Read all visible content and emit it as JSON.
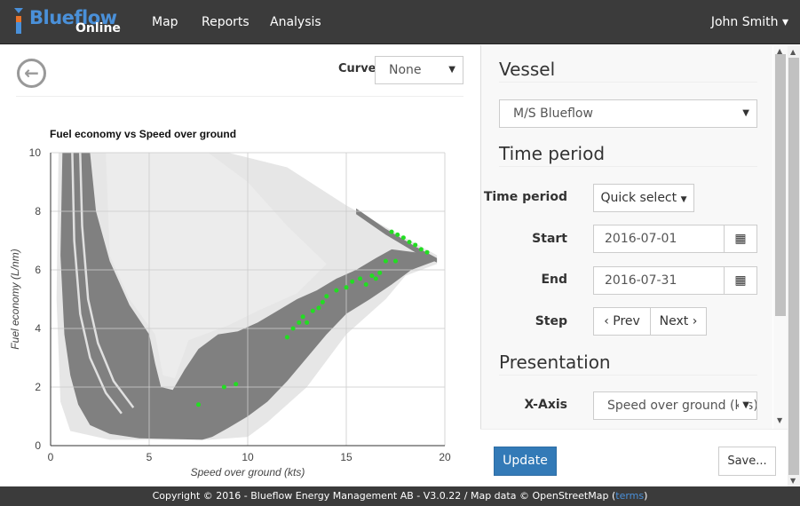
{
  "navbar": {
    "logo_main": "Blueflow",
    "logo_sub": "Online",
    "items": [
      {
        "label": "Map"
      },
      {
        "label": "Reports"
      },
      {
        "label": "Analysis"
      }
    ],
    "user": "John Smith ▾"
  },
  "toolbar": {
    "back_icon": "arrow-left-circle-icon",
    "curve_label": "Curve",
    "curve_value": "None"
  },
  "chart_data": {
    "type": "scatter",
    "title": "Fuel economy vs Speed over ground",
    "xlabel": "Speed over ground (kts)",
    "ylabel": "Fuel economy (L/nm)",
    "xlim": [
      0,
      20
    ],
    "ylim": [
      0,
      10
    ],
    "xticks": [
      "0",
      "5",
      "10",
      "15",
      "20"
    ],
    "yticks": [
      "0",
      "2",
      "4",
      "6",
      "8",
      "10"
    ],
    "grid": true,
    "colors": {
      "density": "#808080",
      "haze": "#e6e6e6",
      "highlight": "#22dd22"
    },
    "density_regions": {
      "haze": [
        [
          0.4,
          10
        ],
        [
          9,
          10
        ],
        [
          12,
          9.5
        ],
        [
          15,
          8.2
        ],
        [
          19.6,
          6.5
        ],
        [
          19.6,
          6.2
        ],
        [
          18,
          5.8
        ],
        [
          17,
          5
        ],
        [
          15,
          3.8
        ],
        [
          13,
          2
        ],
        [
          11,
          0.8
        ],
        [
          10,
          0.3
        ],
        [
          8,
          0.2
        ],
        [
          3,
          0.2
        ],
        [
          1,
          0.5
        ],
        [
          0.5,
          1.5
        ],
        [
          0.3,
          5
        ]
      ],
      "dense": [
        [
          0.6,
          10
        ],
        [
          2,
          10
        ],
        [
          2.3,
          8
        ],
        [
          3,
          6.3
        ],
        [
          4,
          4.8
        ],
        [
          5,
          3.8
        ],
        [
          5.3,
          2.8
        ],
        [
          5.6,
          2
        ],
        [
          6.2,
          1.9
        ],
        [
          6.8,
          2.6
        ],
        [
          7.5,
          3.3
        ],
        [
          8.5,
          3.8
        ],
        [
          9.5,
          3.9
        ],
        [
          10.5,
          4.2
        ],
        [
          11.5,
          4.6
        ],
        [
          12.5,
          5.0
        ],
        [
          13.5,
          5.3
        ],
        [
          14.5,
          5.7
        ],
        [
          15.5,
          6.0
        ],
        [
          16.5,
          6.4
        ],
        [
          17.3,
          6.7
        ],
        [
          18.5,
          6.6
        ],
        [
          19.5,
          6.4
        ],
        [
          19.5,
          6.3
        ],
        [
          18.3,
          6.0
        ],
        [
          17.3,
          5.5
        ],
        [
          16.2,
          5.0
        ],
        [
          15,
          4.5
        ],
        [
          14,
          3.8
        ],
        [
          13,
          3.0
        ],
        [
          12,
          2.2
        ],
        [
          11,
          1.5
        ],
        [
          10,
          1.0
        ],
        [
          9,
          0.6
        ],
        [
          8.2,
          0.3
        ],
        [
          7.7,
          0.2
        ],
        [
          4.5,
          0.25
        ],
        [
          3,
          0.4
        ],
        [
          2,
          0.7
        ],
        [
          1.4,
          1.4
        ],
        [
          1,
          2.4
        ],
        [
          0.7,
          3.8
        ],
        [
          0.5,
          6.5
        ]
      ],
      "upper_band": [
        [
          15.5,
          8.1
        ],
        [
          17,
          7.4
        ],
        [
          18.5,
          6.8
        ],
        [
          19.6,
          6.4
        ],
        [
          19.6,
          6.25
        ],
        [
          18.5,
          6.6
        ],
        [
          17,
          7.2
        ],
        [
          15.5,
          7.9
        ]
      ],
      "stripes": [
        [
          [
            1.1,
            10
          ],
          [
            1.2,
            7
          ],
          [
            1.5,
            4.5
          ],
          [
            2,
            3
          ],
          [
            2.8,
            1.8
          ],
          [
            3.6,
            1.1
          ]
        ],
        [
          [
            1.5,
            10
          ],
          [
            1.6,
            7.5
          ],
          [
            1.9,
            5
          ],
          [
            2.4,
            3.5
          ],
          [
            3.2,
            2.2
          ],
          [
            4.2,
            1.3
          ]
        ]
      ],
      "haze_inside": [
        [
          2.8,
          10
        ],
        [
          8,
          10
        ],
        [
          10,
          9
        ],
        [
          12,
          7.5
        ],
        [
          14,
          6.2
        ],
        [
          12.5,
          5.2
        ],
        [
          10.5,
          4.6
        ],
        [
          9,
          4.1
        ],
        [
          7,
          3.6
        ],
        [
          6.3,
          2.3
        ],
        [
          5.7,
          2.4
        ],
        [
          5.3,
          3.8
        ],
        [
          4,
          5
        ],
        [
          3,
          6.5
        ]
      ]
    },
    "highlight_points": [
      [
        17.3,
        7.3
      ],
      [
        17.6,
        7.2
      ],
      [
        17.9,
        7.1
      ],
      [
        18.2,
        6.95
      ],
      [
        18.5,
        6.85
      ],
      [
        18.8,
        6.7
      ],
      [
        19.1,
        6.6
      ],
      [
        12.0,
        3.7
      ],
      [
        12.3,
        4.0
      ],
      [
        12.6,
        4.2
      ],
      [
        12.8,
        4.4
      ],
      [
        13.0,
        4.2
      ],
      [
        13.3,
        4.6
      ],
      [
        13.6,
        4.7
      ],
      [
        13.8,
        4.9
      ],
      [
        14.0,
        5.1
      ],
      [
        14.5,
        5.3
      ],
      [
        15.0,
        5.4
      ],
      [
        15.3,
        5.6
      ],
      [
        15.7,
        5.7
      ],
      [
        16.0,
        5.5
      ],
      [
        16.3,
        5.8
      ],
      [
        16.5,
        5.7
      ],
      [
        16.7,
        5.9
      ],
      [
        17.0,
        6.3
      ],
      [
        17.5,
        6.3
      ],
      [
        7.5,
        1.4
      ],
      [
        9.4,
        2.1
      ],
      [
        8.8,
        2.0
      ]
    ]
  },
  "sidebar": {
    "vessel_heading": "Vessel",
    "vessel_value": "M/S Blueflow",
    "time_heading": "Time period",
    "time_period_label": "Time period",
    "quick_select": "Quick select",
    "start_label": "Start",
    "start_value": "2016-07-01",
    "end_label": "End",
    "end_value": "2016-07-31",
    "step_label": "Step",
    "prev": "‹ Prev",
    "next": "Next ›",
    "presentation_heading": "Presentation",
    "xaxis_label": "X-Axis",
    "xaxis_value": "Speed over ground (kts)"
  },
  "actions": {
    "update": "Update",
    "save": "Save..."
  },
  "footer": {
    "text": "Copyright © 2016 - Blueflow Energy Management AB - V3.0.22 / Map data © OpenStreetMap (",
    "link": "terms",
    "end": ")"
  }
}
